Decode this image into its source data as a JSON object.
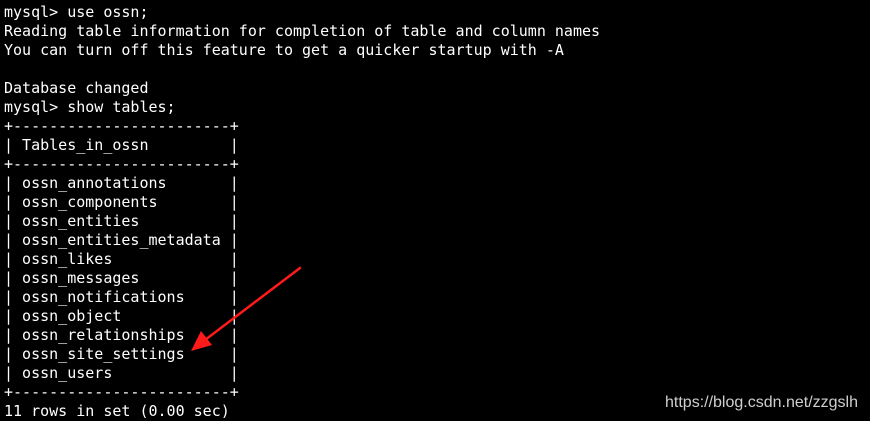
{
  "terminal": {
    "lines": [
      "mysql> use ossn;",
      "Reading table information for completion of table and column names",
      "You can turn off this feature to get a quicker startup with -A",
      "",
      "Database changed",
      "mysql> show tables;",
      "+------------------------+",
      "| Tables_in_ossn         |",
      "+------------------------+",
      "| ossn_annotations       |",
      "| ossn_components        |",
      "| ossn_entities          |",
      "| ossn_entities_metadata |",
      "| ossn_likes             |",
      "| ossn_messages          |",
      "| ossn_notifications     |",
      "| ossn_object            |",
      "| ossn_relationships     |",
      "| ossn_site_settings     |",
      "| ossn_users             |",
      "+------------------------+",
      "11 rows in set (0.00 sec)"
    ],
    "text_color": "#ffffff",
    "background_color": "#000000"
  },
  "watermark": {
    "text": "https://blog.csdn.net/zzgslh"
  },
  "annotation": {
    "color": "#ff1a1a"
  }
}
